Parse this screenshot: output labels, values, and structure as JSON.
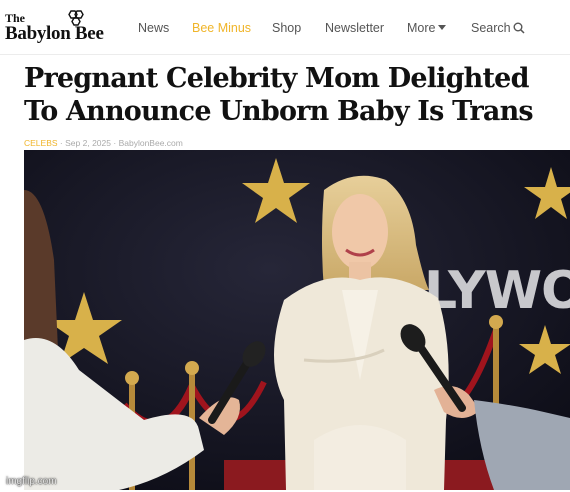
{
  "header": {
    "logo": {
      "the": "The",
      "name": "Babylon Bee"
    },
    "nav": {
      "news": "News",
      "bee_minus": "Bee Minus",
      "shop": "Shop",
      "newsletter": "Newsletter",
      "more": "More",
      "search": "Search"
    },
    "accent_color": "#f0b52a"
  },
  "article": {
    "headline": "Pregnant Celebrity Mom Delighted To Announce Unborn Baby Is Trans",
    "category": "CELEBS",
    "separator": "·",
    "date": "Sep 2, 2025",
    "source": "BabylonBee.com",
    "image": {
      "backdrop_text": "LYWOO",
      "icons": [
        "star-icon",
        "microphone-icon"
      ]
    }
  },
  "watermark": "imgflip.com"
}
